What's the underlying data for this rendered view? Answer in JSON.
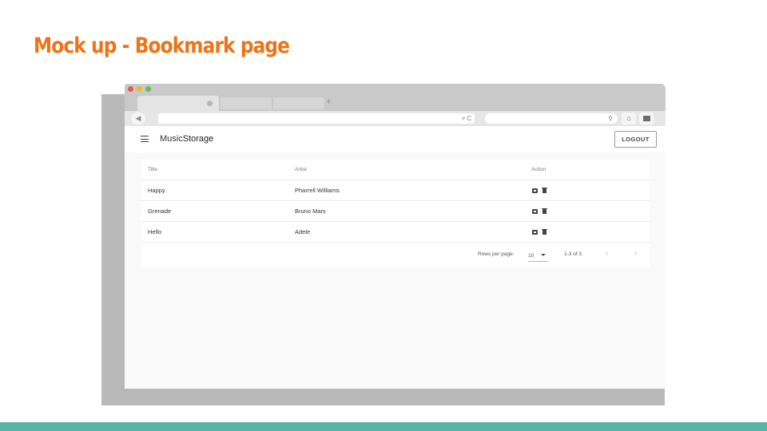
{
  "slide": {
    "title": "Mock up - Bookmark page",
    "accent_color": "#ee7316",
    "footer_bar_color": "#56b4a7"
  },
  "browser": {
    "traffic_lights": [
      "#e8574f",
      "#f2b73a",
      "#5bc24e"
    ],
    "tab_new_icon": "plus-icon",
    "address_icons": "▿ C",
    "back_icon": "◀",
    "home_icon": "home-icon",
    "menu_icon": "menu-square-icon"
  },
  "app": {
    "brand_light": "Music",
    "brand_bold": "Storage",
    "logout_label": "LOGOUT",
    "table": {
      "headers": {
        "title": "Title",
        "artist": "Artist",
        "action": "Action"
      },
      "rows": [
        {
          "title": "Happy",
          "artist": "Pharrell Williams"
        },
        {
          "title": "Grenade",
          "artist": "Bruno Mars"
        },
        {
          "title": "Hello",
          "artist": "Adele"
        }
      ],
      "rows_per_page_label": "Rows per page:",
      "rows_per_page_value": "10",
      "range_label": "1-3 of 3",
      "prev_icon": "‹",
      "next_icon": "›"
    }
  }
}
